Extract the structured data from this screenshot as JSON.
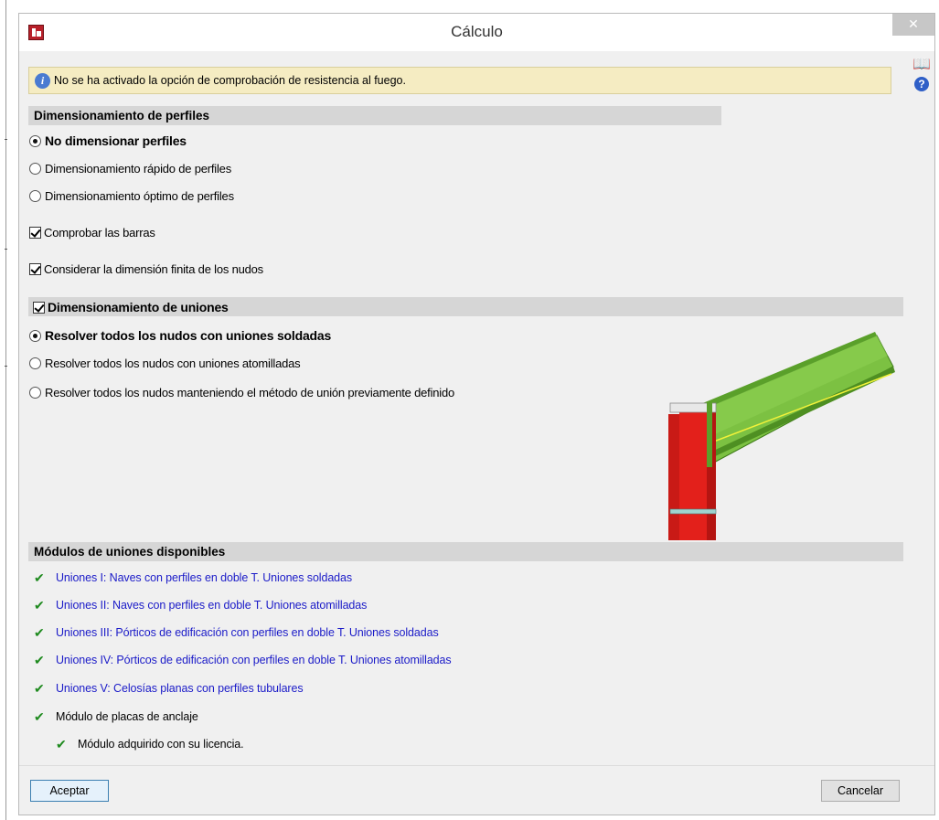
{
  "window": {
    "title": "Cálculo"
  },
  "info": {
    "message": "No se ha activado la opción de comprobación de resistencia al fuego."
  },
  "profiles": {
    "heading": "Dimensionamiento de perfiles",
    "options": [
      {
        "label": "No dimensionar perfiles",
        "selected": true
      },
      {
        "label": "Dimensionamiento rápido de perfiles",
        "selected": false
      },
      {
        "label": "Dimensionamiento óptimo de perfiles",
        "selected": false
      }
    ],
    "checks": [
      {
        "label": "Comprobar las barras",
        "checked": true
      },
      {
        "label": "Considerar la dimensión finita de los nudos",
        "checked": true
      }
    ]
  },
  "joints": {
    "heading": "Dimensionamiento de uniones",
    "enabled": true,
    "options": [
      {
        "label": "Resolver todos los nudos con uniones soldadas",
        "selected": true
      },
      {
        "label": "Resolver todos los nudos con uniones atomilladas",
        "selected": false
      },
      {
        "label": "Resolver todos los nudos manteniendo el método de unión previamente definido",
        "selected": false
      }
    ]
  },
  "modules": {
    "heading": "Módulos de uniones disponibles",
    "items": [
      {
        "label": "Uniones I: Naves con perfiles en doble T. Uniones soldadas",
        "link": true
      },
      {
        "label": "Uniones II: Naves con perfiles en doble T. Uniones atomilladas",
        "link": true
      },
      {
        "label": "Uniones III: Pórticos de edificación con perfiles en doble T. Uniones soldadas",
        "link": true
      },
      {
        "label": "Uniones IV: Pórticos de edificación con perfiles en doble T. Uniones atomilladas",
        "link": true
      },
      {
        "label": "Uniones V: Celosías planas con perfiles tubulares",
        "link": true
      },
      {
        "label": "Módulo de placas de anclaje",
        "link": false
      }
    ],
    "license_note": "Módulo adquirido con su licencia."
  },
  "buttons": {
    "accept": "Aceptar",
    "cancel": "Cancelar"
  },
  "icons": {
    "app": "app-icon",
    "close": "close-icon",
    "info": "info-icon",
    "book": "book-icon",
    "help": "help-icon",
    "check": "check-icon"
  },
  "colors": {
    "banner_bg": "#f5ecc2",
    "section_bg": "#d6d6d6",
    "link": "#1b1bc8",
    "check": "#1e8a1e",
    "column_red": "#e3201b",
    "beam_green": "#7cc142"
  }
}
